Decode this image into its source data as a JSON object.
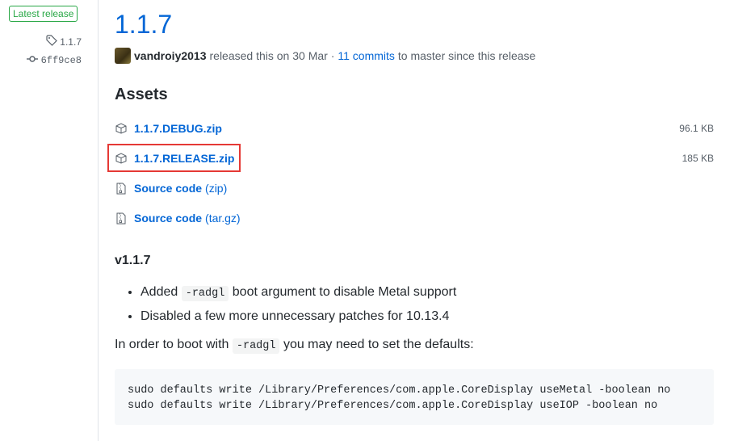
{
  "sidebar": {
    "badge": "Latest release",
    "tag": "1.1.7",
    "commit": "6ff9ce8"
  },
  "release": {
    "title": "1.1.7",
    "author": "vandroiy2013",
    "released_text": "released this on 30 Mar ·",
    "commits_link": "11 commits",
    "commits_suffix": "to master since this release"
  },
  "assets": {
    "heading": "Assets",
    "items": [
      {
        "name": "1.1.7.DEBUG.zip",
        "suffix": "",
        "size": "96.1 KB",
        "icon": "package-icon"
      },
      {
        "name": "1.1.7.RELEASE.zip",
        "suffix": "",
        "size": "185 KB",
        "icon": "package-icon"
      },
      {
        "name": "Source code",
        "suffix": "(zip)",
        "size": "",
        "icon": "file-zip-icon"
      },
      {
        "name": "Source code",
        "suffix": "(tar.gz)",
        "size": "",
        "icon": "file-zip-icon"
      }
    ]
  },
  "notes": {
    "version": "v1.1.7",
    "bullet1_pre": "Added",
    "bullet1_code": "-radgl",
    "bullet1_post": "boot argument to disable Metal support",
    "bullet2": "Disabled a few more unnecessary patches for 10.13.4",
    "para_pre": "In order to boot with",
    "para_code": "-radgl",
    "para_post": "you may need to set the defaults:",
    "code_line1": "sudo defaults write /Library/Preferences/com.apple.CoreDisplay useMetal -boolean no",
    "code_line2": "sudo defaults write /Library/Preferences/com.apple.CoreDisplay useIOP -boolean no"
  },
  "colors": {
    "link": "#0366d6",
    "badge_green": "#28a745",
    "highlight_red": "#e53935"
  }
}
